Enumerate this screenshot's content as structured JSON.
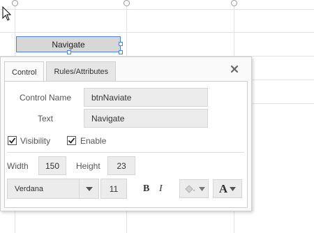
{
  "canvas": {
    "button_label": "Navigate"
  },
  "panel": {
    "tabs": [
      {
        "label": "Control",
        "active": true
      },
      {
        "label": "Rules/Attributes",
        "active": false
      }
    ],
    "control_name_label": "Control Name",
    "control_name_value": "btnNaviate",
    "text_label": "Text",
    "text_value": "Navigate",
    "visibility_label": "Visibility",
    "visibility_checked": true,
    "enable_label": "Enable",
    "enable_checked": true,
    "width_label": "Width",
    "width_value": "150",
    "height_label": "Height",
    "height_value": "23",
    "font_family": "Verdana",
    "font_size": "11",
    "bold_label": "B",
    "italic_label": "I",
    "font_color_glyph": "A"
  },
  "colors": {
    "selection": "#4a86c8",
    "panel_bg": "#fafafa",
    "field_bg": "#ececec"
  }
}
